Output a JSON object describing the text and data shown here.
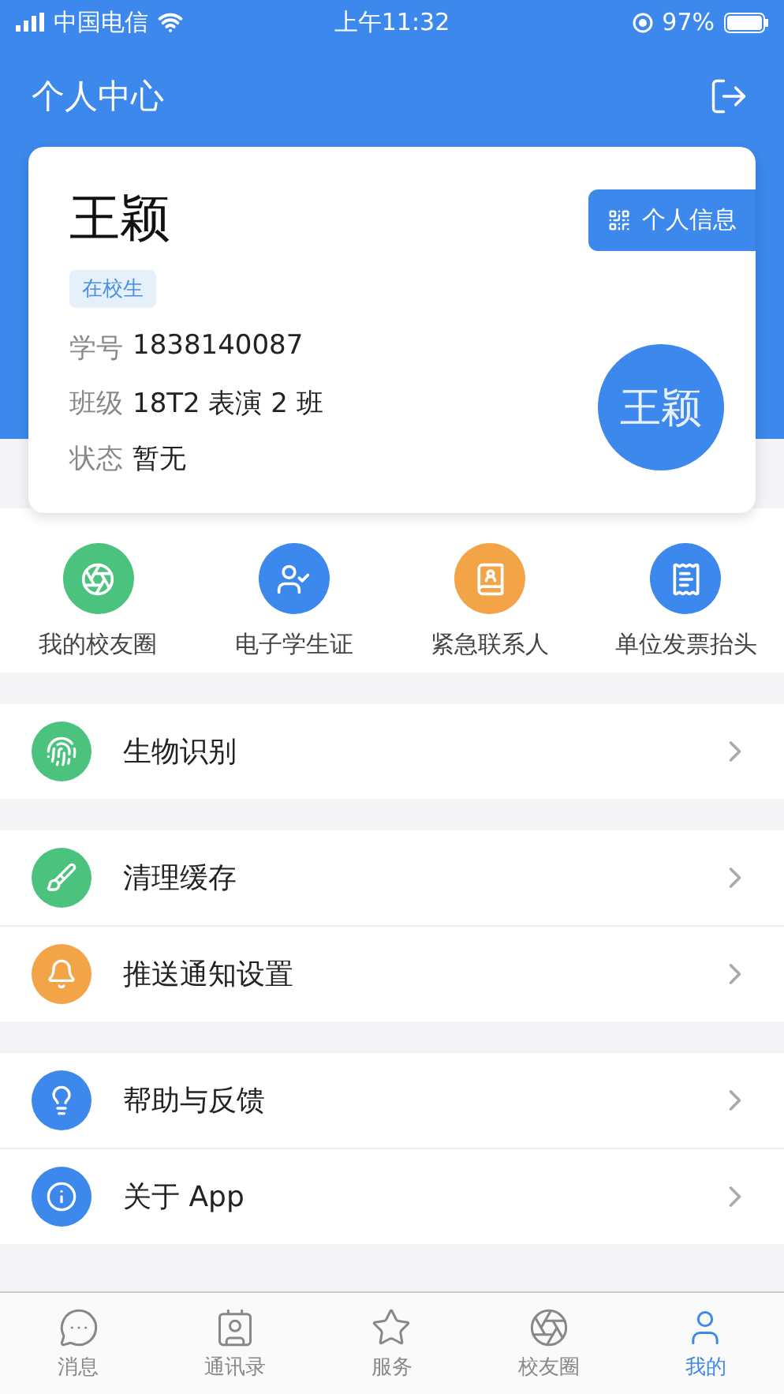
{
  "status_bar": {
    "carrier": "中国电信",
    "time": "上午11:32",
    "battery": "97%"
  },
  "header": {
    "title": "个人中心"
  },
  "profile": {
    "name": "王颖",
    "status_tag": "在校生",
    "info_button": "个人信息",
    "avatar_text": "王颖",
    "fields": [
      {
        "label": "学号",
        "value": "1838140087"
      },
      {
        "label": "班级",
        "value": "18T2 表演 2 班"
      },
      {
        "label": "状态",
        "value": "暂无"
      }
    ]
  },
  "shortcuts": [
    {
      "label": "我的校友圈",
      "kind": "aperture",
      "color": "#4cc27f"
    },
    {
      "label": "电子学生证",
      "kind": "person",
      "color": "#3d88ec"
    },
    {
      "label": "紧急联系人",
      "kind": "contacts",
      "color": "#f2a447"
    },
    {
      "label": "单位发票抬头",
      "kind": "invoice",
      "color": "#3d88ec"
    }
  ],
  "menu_groups": [
    {
      "items": [
        {
          "label": "生物识别",
          "kind": "fingerprint",
          "color": "#4cc27f"
        }
      ]
    },
    {
      "items": [
        {
          "label": "清理缓存",
          "kind": "broom",
          "color": "#4cc27f"
        },
        {
          "label": "推送通知设置",
          "kind": "bell",
          "color": "#f2a447"
        }
      ]
    },
    {
      "items": [
        {
          "label": "帮助与反馈",
          "kind": "bulb",
          "color": "#3d88ec"
        },
        {
          "label": "关于 App",
          "kind": "info",
          "color": "#3d88ec"
        }
      ]
    }
  ],
  "tabs": [
    {
      "label": "消息",
      "kind": "chat",
      "selected": false
    },
    {
      "label": "通讯录",
      "kind": "contact",
      "selected": false
    },
    {
      "label": "服务",
      "kind": "star",
      "selected": false
    },
    {
      "label": "校友圈",
      "kind": "circle",
      "selected": false
    },
    {
      "label": "我的",
      "kind": "user",
      "selected": true
    }
  ]
}
